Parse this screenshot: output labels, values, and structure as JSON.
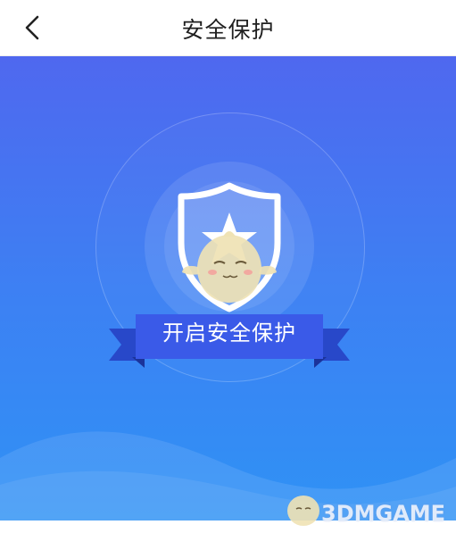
{
  "header": {
    "title": "安全保护",
    "back_icon": "chevron-left-icon"
  },
  "hero": {
    "shield_icon": "shield-star-icon",
    "button_label": "开启安全保护"
  },
  "watermark": {
    "text": "3DMGAME"
  },
  "colors": {
    "gradient_top": "#4f68ef",
    "gradient_bottom": "#2f92f5",
    "ribbon": "#3b5ee8",
    "header_bg": "#ffffff"
  }
}
